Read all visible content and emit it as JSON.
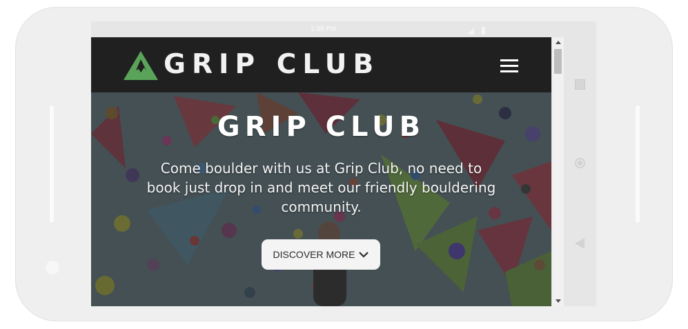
{
  "status_bar": {
    "time": "1:39 PM"
  },
  "header": {
    "logo_text": "GRIP CLUB",
    "logo_icon": "mountain-icon",
    "menu_icon": "hamburger-menu-icon"
  },
  "hero": {
    "title": "GRIP CLUB",
    "text": "Come boulder with us at Grip Club, no need to book just drop in and meet our friendly bouldering community.",
    "button_label": "DISCOVER MORE",
    "button_icon": "chevron-down-icon"
  },
  "colors": {
    "header_bg": "#202020",
    "logo_green": "#5aa35a",
    "button_bg": "#f4f4f4"
  }
}
